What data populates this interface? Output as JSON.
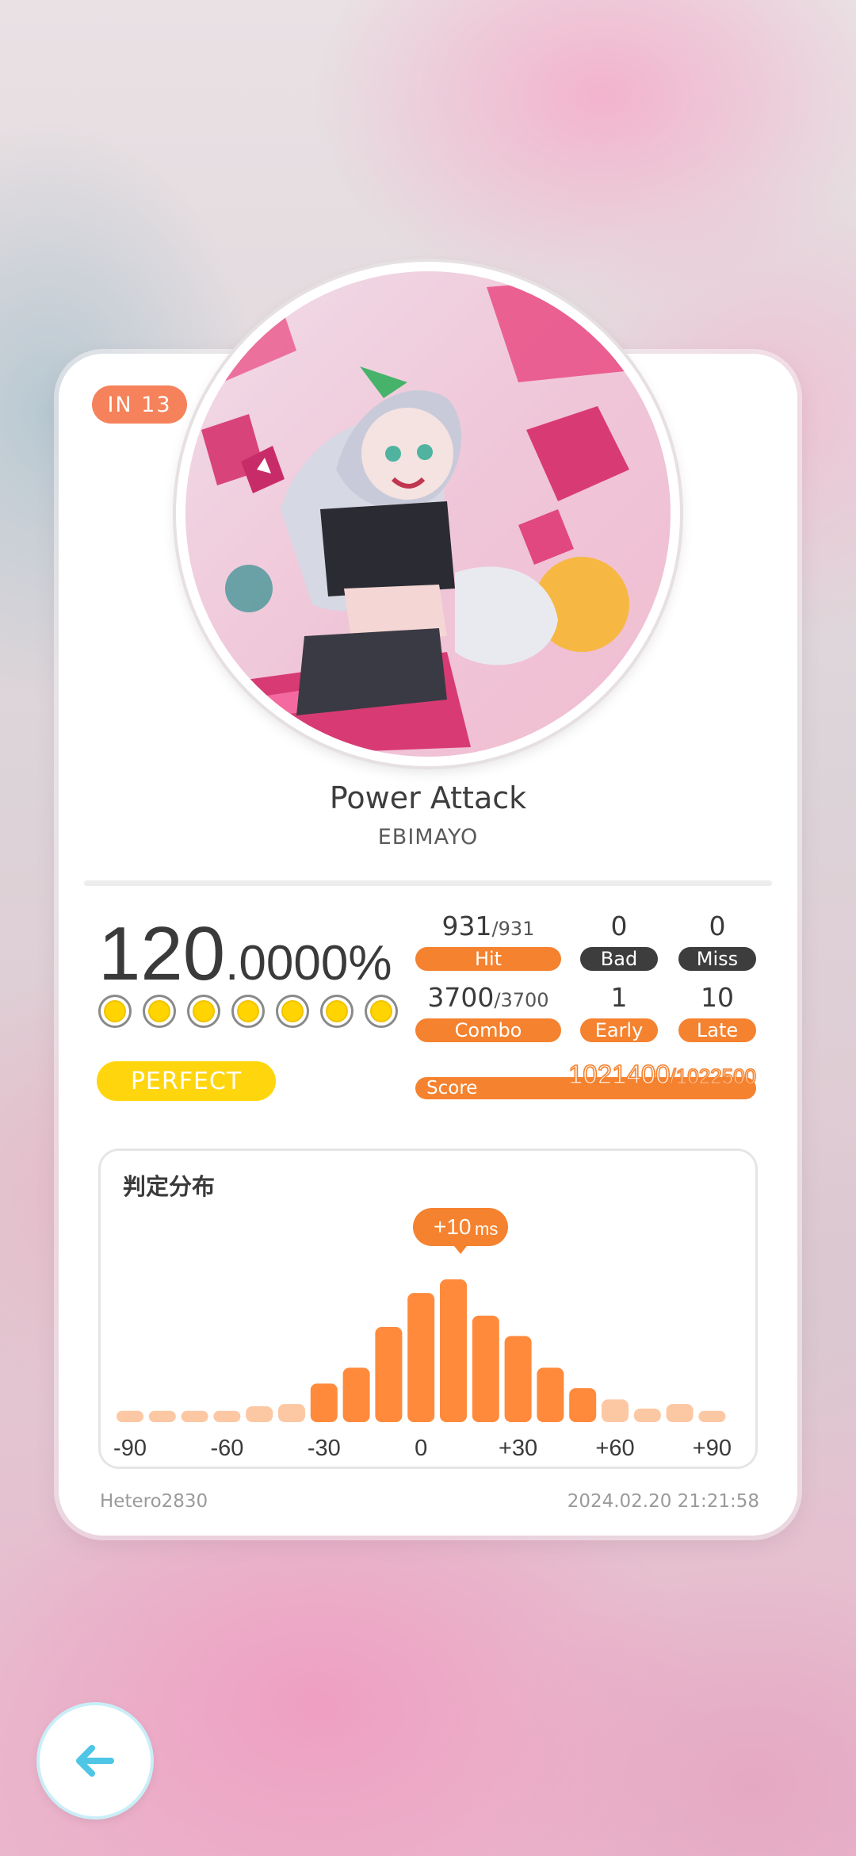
{
  "song": {
    "level_badge": "IN 13",
    "title": "Power Attack",
    "artist": "EBIMAYO",
    "jacket_icon": "song-jacket-artwork"
  },
  "result": {
    "accuracy_int": "120",
    "accuracy_frac": ".0000%",
    "rank_label": "PERFECT",
    "indicator_dots": 7,
    "hit_value": "931",
    "hit_total": "/931",
    "hit_label": "Hit",
    "bad_value": "0",
    "bad_label": "Bad",
    "miss_value": "0",
    "miss_label": "Miss",
    "combo_value": "3700",
    "combo_total": "/3700",
    "combo_label": "Combo",
    "early_value": "1",
    "early_label": "Early",
    "late_value": "10",
    "late_label": "Late",
    "score_label": "Score",
    "score_value": "1021400",
    "score_max": "/1022500"
  },
  "histogram": {
    "title": "判定分布",
    "peak_value": "+10",
    "peak_unit": "ms"
  },
  "footer": {
    "username": "Hetero2830",
    "datetime": "2024.02.20 21:21:58"
  },
  "colors": {
    "accent_orange": "#f5822f",
    "bar_dark": "#ff8a3c",
    "bar_light": "#fcc7a3",
    "rank_yellow": "#ffd60e",
    "back_arrow": "#4fc6e6"
  },
  "chart_data": {
    "type": "bar",
    "title": "判定分布",
    "xlabel": "",
    "ylabel": "",
    "tick_labels": [
      "-90",
      "-60",
      "-30",
      "0",
      "+30",
      "+60",
      "+90"
    ],
    "categories": [
      -90,
      -80,
      -70,
      -60,
      -50,
      -40,
      -30,
      -20,
      -10,
      0,
      10,
      20,
      30,
      40,
      50,
      60,
      70,
      80,
      90
    ],
    "values": [
      5,
      5,
      5,
      5,
      7,
      8,
      17,
      24,
      42,
      57,
      63,
      47,
      38,
      24,
      15,
      10,
      6,
      8,
      5
    ],
    "ylim": [
      0,
      70
    ],
    "highlight": "+10ms",
    "grid": false,
    "legend": "none"
  }
}
